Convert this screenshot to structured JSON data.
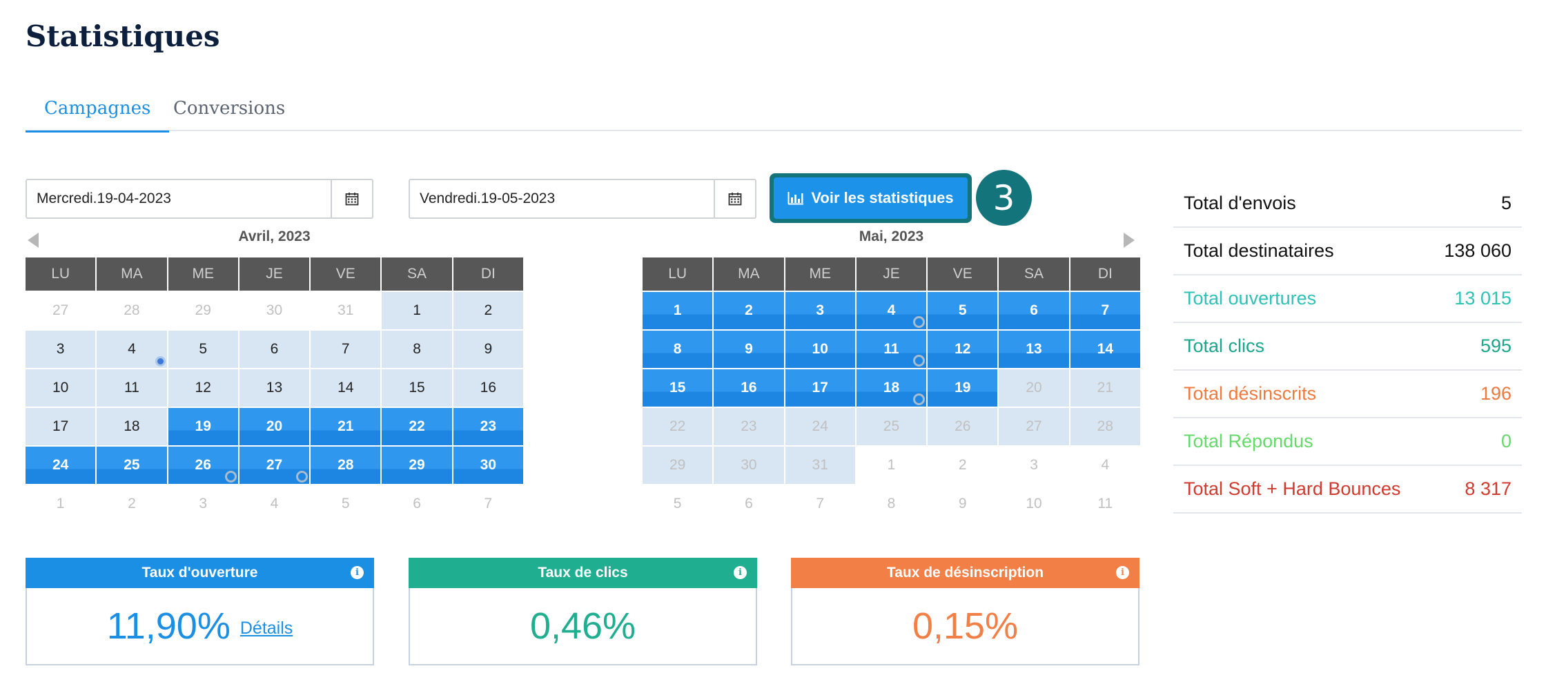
{
  "page": {
    "title": "Statistiques"
  },
  "tabs": [
    {
      "label": "Campagnes",
      "active": true
    },
    {
      "label": "Conversions",
      "active": false
    }
  ],
  "date_range": {
    "start_value": "Mercredi.19-04-2023",
    "end_value": "Vendredi.19-05-2023",
    "calendar_icon": "calendar-icon"
  },
  "action_button": {
    "label": "Voir les statistiques",
    "icon": "bar-chart-icon"
  },
  "step_badge": "3",
  "weekday_headers": [
    "LU",
    "MA",
    "ME",
    "JE",
    "VE",
    "SA",
    "DI"
  ],
  "calendars": [
    {
      "title": "Avril, 2023",
      "rows": [
        [
          {
            "d": "27",
            "s": "muted"
          },
          {
            "d": "28",
            "s": "muted"
          },
          {
            "d": "29",
            "s": "muted"
          },
          {
            "d": "30",
            "s": "muted"
          },
          {
            "d": "31",
            "s": "muted"
          },
          {
            "d": "1",
            "s": "light"
          },
          {
            "d": "2",
            "s": "light"
          }
        ],
        [
          {
            "d": "3",
            "s": "light"
          },
          {
            "d": "4",
            "s": "light",
            "dot": "fill"
          },
          {
            "d": "5",
            "s": "light"
          },
          {
            "d": "6",
            "s": "light"
          },
          {
            "d": "7",
            "s": "light"
          },
          {
            "d": "8",
            "s": "light"
          },
          {
            "d": "9",
            "s": "light"
          }
        ],
        [
          {
            "d": "10",
            "s": "light"
          },
          {
            "d": "11",
            "s": "light"
          },
          {
            "d": "12",
            "s": "light"
          },
          {
            "d": "13",
            "s": "light"
          },
          {
            "d": "14",
            "s": "light"
          },
          {
            "d": "15",
            "s": "light"
          },
          {
            "d": "16",
            "s": "light"
          }
        ],
        [
          {
            "d": "17",
            "s": "light"
          },
          {
            "d": "18",
            "s": "light"
          },
          {
            "d": "19",
            "s": "sel"
          },
          {
            "d": "20",
            "s": "sel"
          },
          {
            "d": "21",
            "s": "sel"
          },
          {
            "d": "22",
            "s": "sel"
          },
          {
            "d": "23",
            "s": "sel"
          }
        ],
        [
          {
            "d": "24",
            "s": "sel"
          },
          {
            "d": "25",
            "s": "sel"
          },
          {
            "d": "26",
            "s": "sel",
            "dot": "ring"
          },
          {
            "d": "27",
            "s": "sel",
            "dot": "ring"
          },
          {
            "d": "28",
            "s": "sel"
          },
          {
            "d": "29",
            "s": "sel"
          },
          {
            "d": "30",
            "s": "sel"
          }
        ],
        [
          {
            "d": "1",
            "s": "muted"
          },
          {
            "d": "2",
            "s": "muted"
          },
          {
            "d": "3",
            "s": "muted"
          },
          {
            "d": "4",
            "s": "muted"
          },
          {
            "d": "5",
            "s": "muted"
          },
          {
            "d": "6",
            "s": "muted"
          },
          {
            "d": "7",
            "s": "muted"
          }
        ]
      ]
    },
    {
      "title": "Mai, 2023",
      "rows": [
        [
          {
            "d": "1",
            "s": "sel"
          },
          {
            "d": "2",
            "s": "sel"
          },
          {
            "d": "3",
            "s": "sel"
          },
          {
            "d": "4",
            "s": "sel",
            "dot": "ring"
          },
          {
            "d": "5",
            "s": "sel"
          },
          {
            "d": "6",
            "s": "sel"
          },
          {
            "d": "7",
            "s": "sel"
          }
        ],
        [
          {
            "d": "8",
            "s": "sel"
          },
          {
            "d": "9",
            "s": "sel"
          },
          {
            "d": "10",
            "s": "sel"
          },
          {
            "d": "11",
            "s": "sel",
            "dot": "ring"
          },
          {
            "d": "12",
            "s": "sel"
          },
          {
            "d": "13",
            "s": "sel"
          },
          {
            "d": "14",
            "s": "sel"
          }
        ],
        [
          {
            "d": "15",
            "s": "sel"
          },
          {
            "d": "16",
            "s": "sel"
          },
          {
            "d": "17",
            "s": "sel"
          },
          {
            "d": "18",
            "s": "sel",
            "dot": "ring"
          },
          {
            "d": "19",
            "s": "sel"
          },
          {
            "d": "20",
            "s": "muted-bg"
          },
          {
            "d": "21",
            "s": "muted-bg"
          }
        ],
        [
          {
            "d": "22",
            "s": "muted-bg"
          },
          {
            "d": "23",
            "s": "muted-bg"
          },
          {
            "d": "24",
            "s": "muted-bg"
          },
          {
            "d": "25",
            "s": "muted-bg"
          },
          {
            "d": "26",
            "s": "muted-bg"
          },
          {
            "d": "27",
            "s": "muted-bg"
          },
          {
            "d": "28",
            "s": "muted-bg"
          }
        ],
        [
          {
            "d": "29",
            "s": "muted-bg"
          },
          {
            "d": "30",
            "s": "muted-bg"
          },
          {
            "d": "31",
            "s": "muted-bg"
          },
          {
            "d": "1",
            "s": "muted"
          },
          {
            "d": "2",
            "s": "muted"
          },
          {
            "d": "3",
            "s": "muted"
          },
          {
            "d": "4",
            "s": "muted"
          }
        ],
        [
          {
            "d": "5",
            "s": "muted"
          },
          {
            "d": "6",
            "s": "muted"
          },
          {
            "d": "7",
            "s": "muted"
          },
          {
            "d": "8",
            "s": "muted"
          },
          {
            "d": "9",
            "s": "muted"
          },
          {
            "d": "10",
            "s": "muted"
          },
          {
            "d": "11",
            "s": "muted"
          }
        ]
      ]
    }
  ],
  "totals": [
    {
      "label": "Total d'envois",
      "value": "5",
      "color": "#111111"
    },
    {
      "label": "Total destinataires",
      "value": "138 060",
      "color": "#111111"
    },
    {
      "label": "Total ouvertures",
      "value": "13 015",
      "color": "#2fc1b6"
    },
    {
      "label": "Total clics",
      "value": "595",
      "color": "#1aa68a"
    },
    {
      "label": "Total désinscrits",
      "value": "196",
      "color": "#ef7a3f"
    },
    {
      "label": "Total Répondus",
      "value": "0",
      "color": "#66d96b"
    },
    {
      "label": "Total Soft + Hard Bounces",
      "value": "8 317",
      "color": "#d03a2f"
    }
  ],
  "rates": [
    {
      "title": "Taux d'ouverture",
      "value": "11,90%",
      "link": "Détails",
      "color": "#1a8fe3",
      "icon": "info-icon"
    },
    {
      "title": "Taux de clics",
      "value": "0,46%",
      "color": "#1fae8f",
      "icon": "info-icon"
    },
    {
      "title": "Taux de désinscription",
      "value": "0,15%",
      "color": "#f27f45",
      "icon": "info-icon"
    }
  ]
}
